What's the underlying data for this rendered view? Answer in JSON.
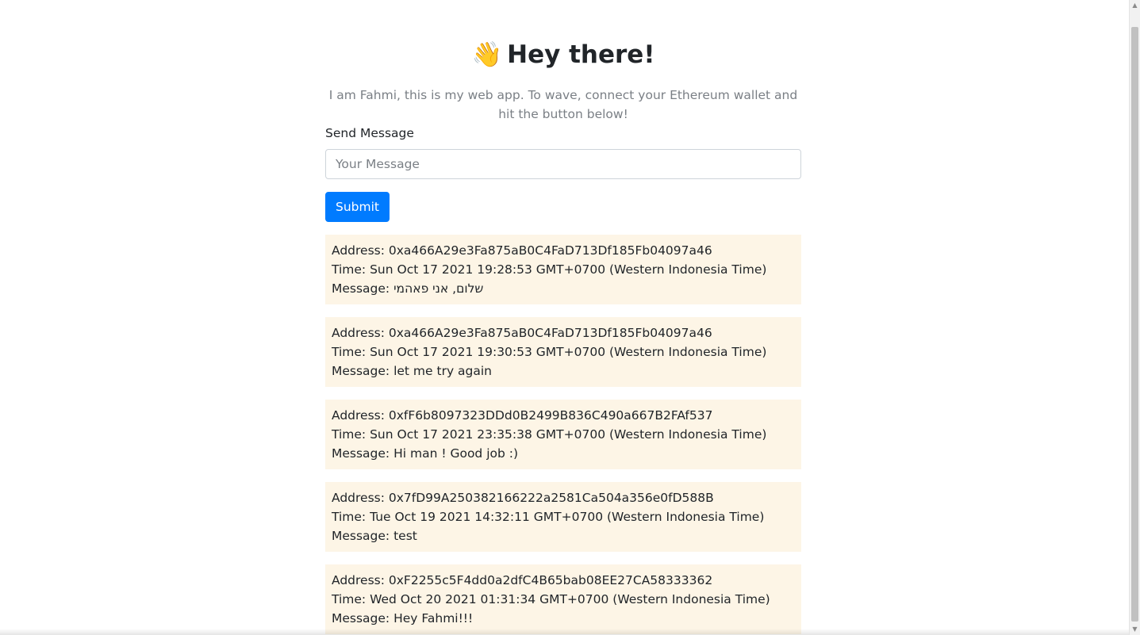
{
  "header": {
    "emoji": "👋",
    "title": "Hey there!"
  },
  "bio": {
    "text": "I am Fahmi, this is my web app. To wave, connect your Ethereum wallet and hit the button below!"
  },
  "form": {
    "label": "Send Message",
    "placeholder": "Your Message",
    "value": "",
    "submit_label": "Submit"
  },
  "waves": [
    {
      "address": "Address: 0xa466A29e3Fa875aB0C4FaD713Df185Fb04097a46",
      "time": "Time: Sun Oct 17 2021 19:28:53 GMT+0700 (Western Indonesia Time)",
      "message": "Message: שלום, אני פאהמי"
    },
    {
      "address": "Address: 0xa466A29e3Fa875aB0C4FaD713Df185Fb04097a46",
      "time": "Time: Sun Oct 17 2021 19:30:53 GMT+0700 (Western Indonesia Time)",
      "message": "Message: let me try again"
    },
    {
      "address": "Address: 0xfF6b8097323DDd0B2499B836C490a667B2FAf537",
      "time": "Time: Sun Oct 17 2021 23:35:38 GMT+0700 (Western Indonesia Time)",
      "message": "Message: Hi man ! Good job :)"
    },
    {
      "address": "Address: 0x7fD99A250382166222a2581Ca504a356e0fD588B",
      "time": "Time: Tue Oct 19 2021 14:32:11 GMT+0700 (Western Indonesia Time)",
      "message": "Message: test"
    },
    {
      "address": "Address: 0xF2255c5F4dd0a2dfC4B65bab08EE27CA58333362",
      "time": "Time: Wed Oct 20 2021 01:31:34 GMT+0700 (Western Indonesia Time)",
      "message": "Message: Hey Fahmi!!!"
    }
  ],
  "colors": {
    "accent": "#007bff",
    "card_background": "#fdf5e6",
    "muted_text": "#7a7f85"
  },
  "scrollbar": {
    "position_fraction": 0.0
  }
}
